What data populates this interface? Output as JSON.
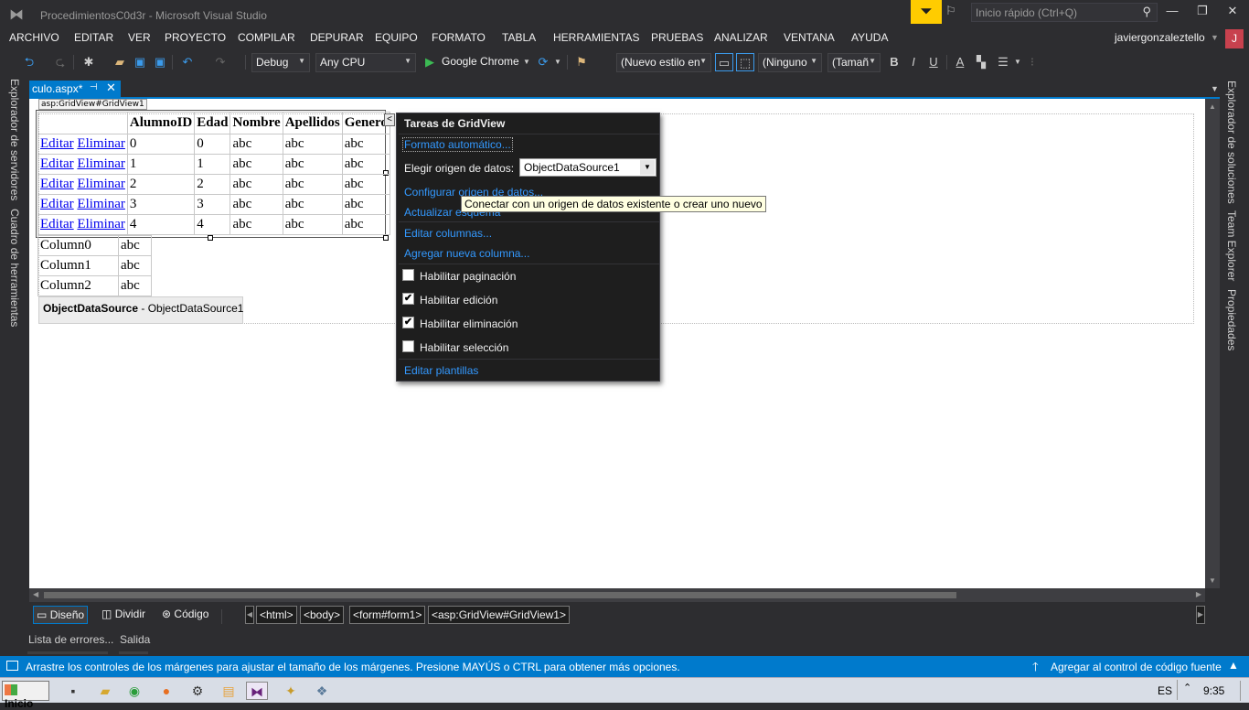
{
  "window": {
    "title": "ProcedimientosC0d3r - Microsoft Visual Studio",
    "quick_launch_placeholder": "Inicio rápido (Ctrl+Q)",
    "user": "javiergonzaleztello",
    "avatar_letter": "J",
    "controls": {
      "minimize": "—",
      "maximize": "❐",
      "close": "✕"
    }
  },
  "menu": [
    "ARCHIVO",
    "EDITAR",
    "VER",
    "PROYECTO",
    "COMPILAR",
    "DEPURAR",
    "EQUIPO",
    "FORMATO",
    "TABLA",
    "HERRAMIENTAS",
    "PRUEBAS",
    "ANALIZAR",
    "VENTANA",
    "AYUDA"
  ],
  "toolbar": {
    "config": "Debug",
    "platform": "Any CPU",
    "run_target": "Google Chrome",
    "style": "(Nuevo estilo en",
    "font": "(Ninguno",
    "size": "(Tamañ",
    "bold": "B",
    "italic": "I",
    "underline": "U",
    "font_color": "A"
  },
  "side_tabs": {
    "left": [
      "Explorador de servidores",
      "Cuadro de herramientas"
    ],
    "right": [
      "Explorador de soluciones",
      "Team Explorer",
      "Propiedades"
    ]
  },
  "document_tab": {
    "label": "culo.aspx*",
    "pin": "⊣",
    "close": "✕"
  },
  "designer": {
    "gridview_label": "asp:GridView#GridView1",
    "grid": {
      "headers": [
        "",
        "AlumnoID",
        "Edad",
        "Nombre",
        "Apellidos",
        "Genero"
      ],
      "rows": [
        {
          "edit": "Editar",
          "delete": "Eliminar",
          "id": "0",
          "edad": "0",
          "nombre": "abc",
          "apellidos": "abc",
          "genero": "abc"
        },
        {
          "edit": "Editar",
          "delete": "Eliminar",
          "id": "1",
          "edad": "1",
          "nombre": "abc",
          "apellidos": "abc",
          "genero": "abc"
        },
        {
          "edit": "Editar",
          "delete": "Eliminar",
          "id": "2",
          "edad": "2",
          "nombre": "abc",
          "apellidos": "abc",
          "genero": "abc"
        },
        {
          "edit": "Editar",
          "delete": "Eliminar",
          "id": "3",
          "edad": "3",
          "nombre": "abc",
          "apellidos": "abc",
          "genero": "abc"
        },
        {
          "edit": "Editar",
          "delete": "Eliminar",
          "id": "4",
          "edad": "4",
          "nombre": "abc",
          "apellidos": "abc",
          "genero": "abc"
        }
      ]
    },
    "preview_table": [
      {
        "col": "Column0",
        "val": "abc"
      },
      {
        "col": "Column1",
        "val": "abc"
      },
      {
        "col": "Column2",
        "val": "abc"
      }
    ],
    "object_data_source": {
      "type": "ObjectDataSource",
      "name": " - ObjectDataSource1"
    }
  },
  "task_panel": {
    "title": "Tareas de GridView",
    "auto_format": "Formato automático...",
    "choose_source_label": "Elegir origen de datos:",
    "choose_source_value": "ObjectDataSource1",
    "configure_source": "Configurar origen de datos...",
    "refresh_schema": "Actualizar esquema",
    "edit_columns": "Editar columnas...",
    "add_column": "Agregar nueva columna...",
    "checkboxes": [
      {
        "label": "Habilitar paginación",
        "checked": false
      },
      {
        "label": "Habilitar edición",
        "checked": true
      },
      {
        "label": "Habilitar eliminación",
        "checked": true
      },
      {
        "label": "Habilitar selección",
        "checked": false
      }
    ],
    "edit_templates": "Editar plantillas",
    "tooltip": "Conectar con un origen de datos existente o crear uno nuevo"
  },
  "view_bar": {
    "design": "Diseño",
    "split": "Dividir",
    "code": "Código",
    "breadcrumbs": [
      "<html>",
      "<body>",
      "<form#form1>",
      "<asp:GridView#GridView1>"
    ]
  },
  "bottom_tabs": [
    "Lista de errores...",
    "Salida"
  ],
  "status": {
    "message": "Arrastre los controles de los márgenes para ajustar el tamaño de los márgenes. Presione MAYÚS o CTRL para obtener más opciones.",
    "source_control": "Agregar al control de código fuente"
  },
  "taskbar": {
    "start": "Inicio",
    "language": "ES",
    "time": "9:35"
  }
}
